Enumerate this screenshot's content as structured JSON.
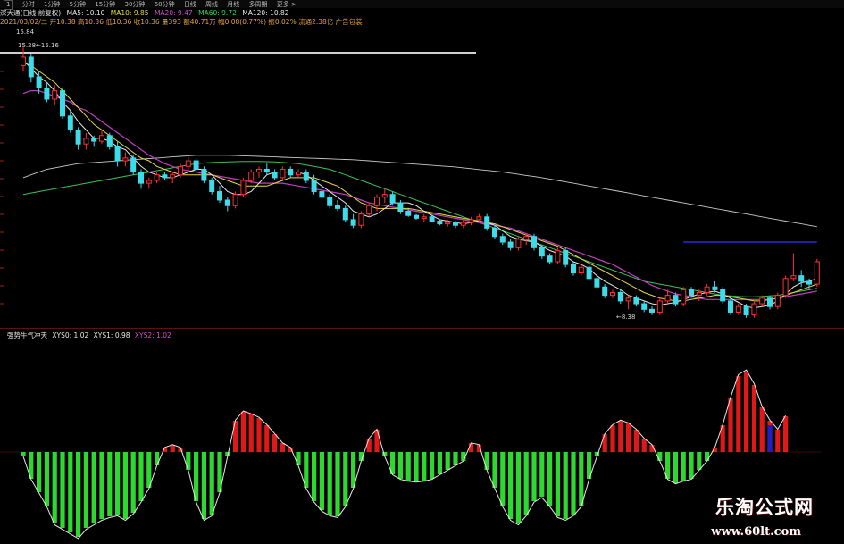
{
  "toolbar": {
    "items": [
      "1",
      "分时",
      "1分钟",
      "5分钟",
      "15分钟",
      "30分钟",
      "60分钟",
      "日线",
      "周线",
      "月线",
      "多周期",
      "更多 >"
    ]
  },
  "price_header": {
    "name": "深大通(日线 前复权)",
    "ma5": "MA5: 10.10",
    "ma10": "MA10: 9.85",
    "ma20": "MA20: 9.47",
    "ma60": "MA60: 9.72",
    "ma120": "MA120: 10.82",
    "info": "2021/03/02/二 开10.38 高10.36 低10.36 收10.36 量393 额40.71万 幅0.08(0.77%) 振0.02% 流通2.38亿 广告包装"
  },
  "price_labels": {
    "high": "15.84",
    "high_range": "15.28←15.16",
    "low": "←8.38"
  },
  "indicator_header": {
    "name": "强势牛气冲天",
    "xys0": "XYS0: 1.02",
    "xys1": "XYS1: 0.98",
    "xys2": "XYS2: 1.02"
  },
  "watermark": {
    "brand": "乐淘公式网",
    "url": "www.60lt.com"
  },
  "colors": {
    "up": "#ff3030",
    "down": "#3ddcea",
    "ma5": "#e8e8e8",
    "ma10": "#e6d84a",
    "ma20": "#c040c0",
    "ma60": "#3dc05a",
    "ma120": "#c8c8c8",
    "bar_pos": "#e01818",
    "bar_neg": "#2ed82e",
    "bar_blue": "#2020c0"
  },
  "chart_data": {
    "type": "candlestick",
    "candles": [
      [
        15.2,
        15.84,
        15.0,
        15.5
      ],
      [
        15.5,
        15.6,
        14.6,
        14.8
      ],
      [
        14.8,
        15.0,
        14.2,
        14.4
      ],
      [
        14.4,
        14.6,
        13.9,
        14.0
      ],
      [
        14.0,
        14.5,
        13.8,
        14.3
      ],
      [
        14.3,
        14.4,
        13.3,
        13.4
      ],
      [
        13.4,
        13.6,
        12.8,
        12.9
      ],
      [
        12.9,
        13.0,
        12.2,
        12.4
      ],
      [
        12.4,
        12.8,
        12.2,
        12.6
      ],
      [
        12.6,
        12.7,
        12.3,
        12.5
      ],
      [
        12.5,
        12.9,
        12.4,
        12.7
      ],
      [
        12.7,
        12.8,
        12.2,
        12.3
      ],
      [
        12.3,
        12.5,
        11.6,
        11.8
      ],
      [
        11.8,
        12.1,
        11.6,
        11.9
      ],
      [
        11.9,
        12.0,
        11.3,
        11.4
      ],
      [
        11.4,
        11.5,
        10.8,
        11.0
      ],
      [
        11.0,
        11.2,
        10.8,
        11.1
      ],
      [
        11.1,
        11.4,
        11.0,
        11.3
      ],
      [
        11.3,
        11.4,
        11.1,
        11.2
      ],
      [
        11.2,
        11.4,
        11.0,
        11.3
      ],
      [
        11.3,
        11.7,
        11.2,
        11.6
      ],
      [
        11.6,
        12.0,
        11.4,
        11.8
      ],
      [
        11.8,
        11.9,
        11.4,
        11.5
      ],
      [
        11.5,
        11.6,
        11.0,
        11.1
      ],
      [
        11.1,
        11.2,
        10.6,
        10.7
      ],
      [
        10.7,
        10.9,
        10.3,
        10.4
      ],
      [
        10.4,
        10.5,
        10.0,
        10.2
      ],
      [
        10.2,
        10.7,
        10.1,
        10.6
      ],
      [
        10.6,
        11.2,
        10.5,
        11.1
      ],
      [
        11.1,
        11.5,
        11.0,
        11.4
      ],
      [
        11.4,
        11.6,
        11.2,
        11.5
      ],
      [
        11.5,
        11.7,
        11.3,
        11.4
      ],
      [
        11.4,
        11.5,
        11.1,
        11.2
      ],
      [
        11.2,
        11.6,
        11.1,
        11.5
      ],
      [
        11.5,
        11.6,
        11.2,
        11.3
      ],
      [
        11.3,
        11.5,
        11.2,
        11.4
      ],
      [
        11.4,
        11.5,
        11.0,
        11.1
      ],
      [
        11.1,
        11.3,
        10.6,
        10.7
      ],
      [
        10.7,
        10.9,
        10.4,
        10.5
      ],
      [
        10.5,
        10.6,
        10.1,
        10.2
      ],
      [
        10.2,
        10.4,
        10.0,
        10.1
      ],
      [
        10.1,
        10.2,
        9.6,
        9.7
      ],
      [
        9.7,
        9.9,
        9.4,
        9.5
      ],
      [
        9.5,
        10.0,
        9.4,
        9.9
      ],
      [
        9.9,
        10.3,
        9.8,
        10.2
      ],
      [
        10.2,
        10.6,
        10.0,
        10.5
      ],
      [
        10.5,
        10.8,
        10.3,
        10.6
      ],
      [
        10.6,
        10.7,
        10.2,
        10.3
      ],
      [
        10.3,
        10.4,
        9.9,
        10.0
      ],
      [
        10.0,
        10.1,
        9.8,
        9.85
      ],
      [
        9.85,
        9.9,
        9.7,
        9.75
      ],
      [
        9.75,
        9.9,
        9.6,
        9.8
      ],
      [
        9.8,
        9.85,
        9.6,
        9.65
      ],
      [
        9.65,
        9.7,
        9.5,
        9.55
      ],
      [
        9.55,
        9.7,
        9.45,
        9.6
      ],
      [
        9.6,
        9.65,
        9.4,
        9.5
      ],
      [
        9.5,
        9.7,
        9.4,
        9.6
      ],
      [
        9.6,
        9.8,
        9.5,
        9.7
      ],
      [
        9.7,
        9.9,
        9.6,
        9.8
      ],
      [
        9.8,
        9.9,
        9.3,
        9.4
      ],
      [
        9.4,
        9.5,
        9.0,
        9.1
      ],
      [
        9.1,
        9.2,
        8.8,
        8.9
      ],
      [
        8.9,
        9.0,
        8.6,
        8.7
      ],
      [
        8.7,
        9.1,
        8.6,
        9.0
      ],
      [
        9.0,
        9.2,
        8.8,
        9.1
      ],
      [
        9.1,
        9.2,
        8.6,
        8.7
      ],
      [
        8.7,
        8.8,
        8.3,
        8.4
      ],
      [
        8.4,
        8.5,
        8.1,
        8.2
      ],
      [
        8.2,
        8.7,
        8.1,
        8.6
      ],
      [
        8.6,
        8.7,
        8.0,
        8.1
      ],
      [
        8.1,
        8.2,
        7.7,
        7.8
      ],
      [
        7.8,
        8.1,
        7.7,
        8.0
      ],
      [
        8.0,
        8.1,
        7.5,
        7.6
      ],
      [
        7.6,
        7.7,
        7.2,
        7.3
      ],
      [
        7.3,
        7.4,
        6.9,
        7.0
      ],
      [
        7.0,
        7.2,
        6.9,
        7.1
      ],
      [
        7.1,
        7.2,
        6.7,
        6.8
      ],
      [
        6.8,
        7.0,
        6.5,
        6.9
      ],
      [
        6.9,
        7.0,
        6.6,
        6.7
      ],
      [
        6.7,
        6.8,
        6.4,
        6.5
      ],
      [
        6.5,
        6.6,
        6.3,
        6.4
      ],
      [
        6.4,
        6.9,
        6.3,
        6.8
      ],
      [
        6.8,
        7.2,
        6.7,
        7.0
      ],
      [
        7.0,
        7.1,
        6.6,
        6.7
      ],
      [
        6.7,
        7.3,
        6.6,
        7.2
      ],
      [
        7.2,
        7.3,
        6.9,
        7.0
      ],
      [
        7.0,
        7.2,
        6.8,
        7.1
      ],
      [
        7.1,
        7.4,
        7.0,
        7.3
      ],
      [
        7.3,
        7.5,
        7.1,
        7.2
      ],
      [
        7.2,
        7.3,
        6.7,
        6.8
      ],
      [
        6.8,
        6.9,
        6.3,
        6.4
      ],
      [
        6.4,
        6.7,
        6.3,
        6.6
      ],
      [
        6.6,
        6.7,
        6.2,
        6.3
      ],
      [
        6.3,
        6.8,
        6.2,
        6.7
      ],
      [
        6.7,
        7.0,
        6.6,
        6.9
      ],
      [
        6.9,
        7.0,
        6.5,
        6.6
      ],
      [
        6.6,
        7.1,
        6.5,
        7.0
      ],
      [
        7.0,
        7.7,
        6.9,
        7.6
      ],
      [
        7.6,
        8.5,
        7.5,
        7.7
      ],
      [
        7.7,
        7.9,
        7.3,
        7.5
      ],
      [
        7.5,
        7.6,
        7.2,
        7.4
      ],
      [
        7.4,
        8.3,
        7.3,
        8.2
      ]
    ],
    "ma5": [
      15.4,
      15.1,
      14.8,
      14.6,
      14.3,
      13.9,
      13.6,
      13.2,
      12.9,
      12.6,
      12.6,
      12.5,
      12.3,
      12.2,
      11.9,
      11.6,
      11.4,
      11.3,
      11.2,
      11.2,
      11.3,
      11.4,
      11.5,
      11.5,
      11.3,
      11.0,
      10.7,
      10.6,
      10.6,
      10.7,
      11.0,
      11.3,
      11.4,
      11.4,
      11.4,
      11.4,
      11.3,
      11.1,
      10.9,
      10.7,
      10.5,
      10.3,
      10.0,
      9.9,
      9.8,
      9.9,
      10.1,
      10.3,
      10.3,
      10.3,
      10.2,
      10.0,
      9.85,
      9.7,
      9.65,
      9.6,
      9.55,
      9.6,
      9.65,
      9.6,
      9.5,
      9.3,
      9.1,
      9.0,
      8.95,
      8.9,
      8.75,
      8.6,
      8.5,
      8.4,
      8.2,
      8.1,
      7.95,
      7.7,
      7.5,
      7.35,
      7.2,
      7.0,
      6.9,
      6.8,
      6.7,
      6.65,
      6.7,
      6.75,
      6.85,
      6.95,
      7.05,
      7.1,
      7.15,
      7.05,
      6.9,
      6.75,
      6.6,
      6.55,
      6.6,
      6.65,
      6.8,
      7.05,
      7.3,
      7.45,
      7.5,
      7.6
    ],
    "ma10": [
      15.3,
      15.2,
      15.0,
      14.8,
      14.6,
      14.3,
      14.0,
      13.7,
      13.4,
      13.1,
      12.9,
      12.7,
      12.5,
      12.3,
      12.1,
      11.9,
      11.8,
      11.6,
      11.5,
      11.4,
      11.3,
      11.3,
      11.3,
      11.3,
      11.3,
      11.2,
      11.1,
      11.0,
      10.9,
      10.9,
      10.9,
      10.9,
      11.0,
      11.1,
      11.2,
      11.2,
      11.2,
      11.2,
      11.1,
      11.0,
      10.9,
      10.7,
      10.5,
      10.3,
      10.2,
      10.1,
      10.1,
      10.1,
      10.1,
      10.1,
      10.05,
      10.0,
      9.95,
      9.9,
      9.85,
      9.8,
      9.75,
      9.7,
      9.65,
      9.6,
      9.55,
      9.45,
      9.35,
      9.25,
      9.15,
      9.05,
      8.95,
      8.85,
      8.75,
      8.6,
      8.45,
      8.3,
      8.15,
      8.0,
      7.85,
      7.7,
      7.55,
      7.4,
      7.25,
      7.1,
      7.0,
      6.9,
      6.85,
      6.8,
      6.8,
      6.85,
      6.9,
      6.95,
      7.0,
      7.0,
      6.95,
      6.9,
      6.85,
      6.8,
      6.8,
      6.85,
      6.9,
      7.0,
      7.1,
      7.2,
      7.3,
      7.4
    ],
    "ma20": [
      14.2,
      14.3,
      14.3,
      14.2,
      14.1,
      14.0,
      13.9,
      13.7,
      13.6,
      13.4,
      13.2,
      13.0,
      12.8,
      12.6,
      12.4,
      12.2,
      12.0,
      11.85,
      11.7,
      11.6,
      11.5,
      11.45,
      11.4,
      11.35,
      11.3,
      11.25,
      11.2,
      11.15,
      11.1,
      11.05,
      11.0,
      11.0,
      11.0,
      11.0,
      10.95,
      10.9,
      10.85,
      10.8,
      10.75,
      10.7,
      10.65,
      10.6,
      10.5,
      10.4,
      10.3,
      10.25,
      10.2,
      10.15,
      10.1,
      10.05,
      10.0,
      9.95,
      9.9,
      9.85,
      9.8,
      9.75,
      9.7,
      9.65,
      9.6,
      9.55,
      9.5,
      9.45,
      9.4,
      9.3,
      9.2,
      9.1,
      9.0,
      8.9,
      8.8,
      8.7,
      8.6,
      8.5,
      8.4,
      8.3,
      8.2,
      8.1,
      7.95,
      7.8,
      7.65,
      7.5,
      7.35,
      7.25,
      7.15,
      7.05,
      7.0,
      6.95,
      6.9,
      6.85,
      6.85,
      6.85,
      6.85,
      6.85,
      6.85,
      6.85,
      6.85,
      6.85,
      6.9,
      6.95,
      7.0,
      7.05,
      7.1,
      7.15
    ],
    "ma60": [
      10.6,
      10.65,
      10.7,
      10.75,
      10.8,
      10.85,
      10.9,
      10.95,
      11.0,
      11.05,
      11.1,
      11.15,
      11.2,
      11.25,
      11.3,
      11.35,
      11.4,
      11.45,
      11.5,
      11.55,
      11.6,
      11.65,
      11.7,
      11.72,
      11.74,
      11.75,
      11.76,
      11.77,
      11.78,
      11.78,
      11.78,
      11.77,
      11.76,
      11.74,
      11.72,
      11.7,
      11.65,
      11.6,
      11.55,
      11.5,
      11.4,
      11.3,
      11.2,
      11.1,
      11.0,
      10.9,
      10.8,
      10.7,
      10.6,
      10.5,
      10.4,
      10.3,
      10.2,
      10.1,
      10.0,
      9.9,
      9.8,
      9.7,
      9.6,
      9.5,
      9.4,
      9.3,
      9.2,
      9.1,
      9.0,
      8.9,
      8.8,
      8.7,
      8.6,
      8.5,
      8.4,
      8.3,
      8.2,
      8.1,
      8.0,
      7.9,
      7.8,
      7.7,
      7.6,
      7.5,
      7.45,
      7.4,
      7.35,
      7.3,
      7.25,
      7.2,
      7.15,
      7.1,
      7.05,
      7.0,
      6.98,
      6.96,
      6.95,
      6.95,
      6.96,
      6.98,
      7.0,
      7.05,
      7.1,
      7.15,
      7.2,
      7.25
    ],
    "ma120": [
      11.2,
      11.3,
      11.4,
      11.5,
      11.55,
      11.6,
      11.65,
      11.7,
      11.72,
      11.74,
      11.76,
      11.78,
      11.8,
      11.82,
      11.84,
      11.86,
      11.88,
      11.9,
      11.92,
      11.94,
      11.96,
      11.98,
      12.0,
      12.0,
      12.0,
      12.0,
      12.0,
      11.99,
      11.98,
      11.97,
      11.96,
      11.95,
      11.94,
      11.93,
      11.92,
      11.91,
      11.9,
      11.89,
      11.88,
      11.87,
      11.86,
      11.85,
      11.84,
      11.82,
      11.8,
      11.78,
      11.76,
      11.74,
      11.72,
      11.7,
      11.68,
      11.66,
      11.64,
      11.62,
      11.6,
      11.58,
      11.55,
      11.52,
      11.49,
      11.46,
      11.43,
      11.4,
      11.36,
      11.32,
      11.28,
      11.24,
      11.2,
      11.15,
      11.1,
      11.05,
      11.0,
      10.95,
      10.9,
      10.85,
      10.8,
      10.75,
      10.7,
      10.65,
      10.6,
      10.55,
      10.5,
      10.45,
      10.4,
      10.35,
      10.3,
      10.25,
      10.2,
      10.15,
      10.1,
      10.05,
      10.0,
      9.95,
      9.9,
      9.85,
      9.8,
      9.75,
      9.7,
      9.65,
      9.6,
      9.55,
      9.5,
      9.45
    ],
    "blue_line": {
      "start_index": 84,
      "value": 8.9
    },
    "ylim": [
      6.0,
      16.2
    ],
    "indicator": {
      "values": [
        -0.05,
        -0.3,
        -0.45,
        -0.6,
        -0.8,
        -0.85,
        -0.9,
        -0.95,
        -0.85,
        -0.8,
        -0.75,
        -0.72,
        -0.7,
        -0.75,
        -0.68,
        -0.55,
        -0.4,
        -0.15,
        0.05,
        0.08,
        0.05,
        -0.2,
        -0.55,
        -0.75,
        -0.7,
        -0.45,
        -0.05,
        0.35,
        0.45,
        0.42,
        0.38,
        0.3,
        0.2,
        0.1,
        0.05,
        -0.15,
        -0.4,
        -0.55,
        -0.65,
        -0.7,
        -0.72,
        -0.6,
        -0.4,
        -0.1,
        0.15,
        0.25,
        -0.05,
        -0.25,
        -0.3,
        -0.32,
        -0.33,
        -0.32,
        -0.3,
        -0.25,
        -0.2,
        -0.15,
        -0.1,
        0.1,
        0.08,
        -0.2,
        -0.4,
        -0.6,
        -0.75,
        -0.8,
        -0.7,
        -0.55,
        -0.5,
        -0.6,
        -0.72,
        -0.75,
        -0.7,
        -0.6,
        -0.3,
        -0.05,
        0.2,
        0.3,
        0.35,
        0.32,
        0.25,
        0.15,
        0.08,
        -0.1,
        -0.3,
        -0.35,
        -0.32,
        -0.3,
        -0.2,
        -0.1,
        0.05,
        0.3,
        0.6,
        0.85,
        0.9,
        0.75,
        0.5,
        0.35,
        0.25,
        0.4
      ],
      "blue_bar": {
        "index": 95,
        "value": 0.3
      },
      "ylim": [
        -1.0,
        1.0
      ]
    }
  }
}
